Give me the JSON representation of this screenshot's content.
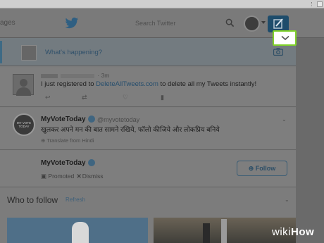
{
  "header": {
    "messages_label": "ages",
    "search_placeholder": "Search Twitter",
    "bird_icon": "twitter-bird-icon",
    "compose_icon": "compose-tweet-icon"
  },
  "composer": {
    "placeholder": "What's happening?"
  },
  "tweet": {
    "time": "· 3m",
    "text_before": "I just registered to ",
    "link": "DeleteAllTweets.com",
    "text_after": " to delete all my Tweets instantly!"
  },
  "promoted_tweet": {
    "avatar_text": "MY VOTE TODAY",
    "name": "MyVoteToday",
    "handle": "@myvotetoday",
    "text": "खुलकर अपने मन की बात सामने रखिये, फॉलो कीजिये और लोकप्रिय बनिये",
    "translate": "Translate from Hindi"
  },
  "promoted_account": {
    "name": "MyVoteToday",
    "promoted_label": "Promoted",
    "dismiss_label": "Dismiss",
    "follow_label": "Follow"
  },
  "who_to_follow": {
    "title": "Who to follow",
    "refresh": "Refresh"
  },
  "watermark": {
    "prefix": "wiki",
    "suffix": "How"
  },
  "colors": {
    "highlight": "#7fd12a",
    "link": "#264e6d"
  }
}
